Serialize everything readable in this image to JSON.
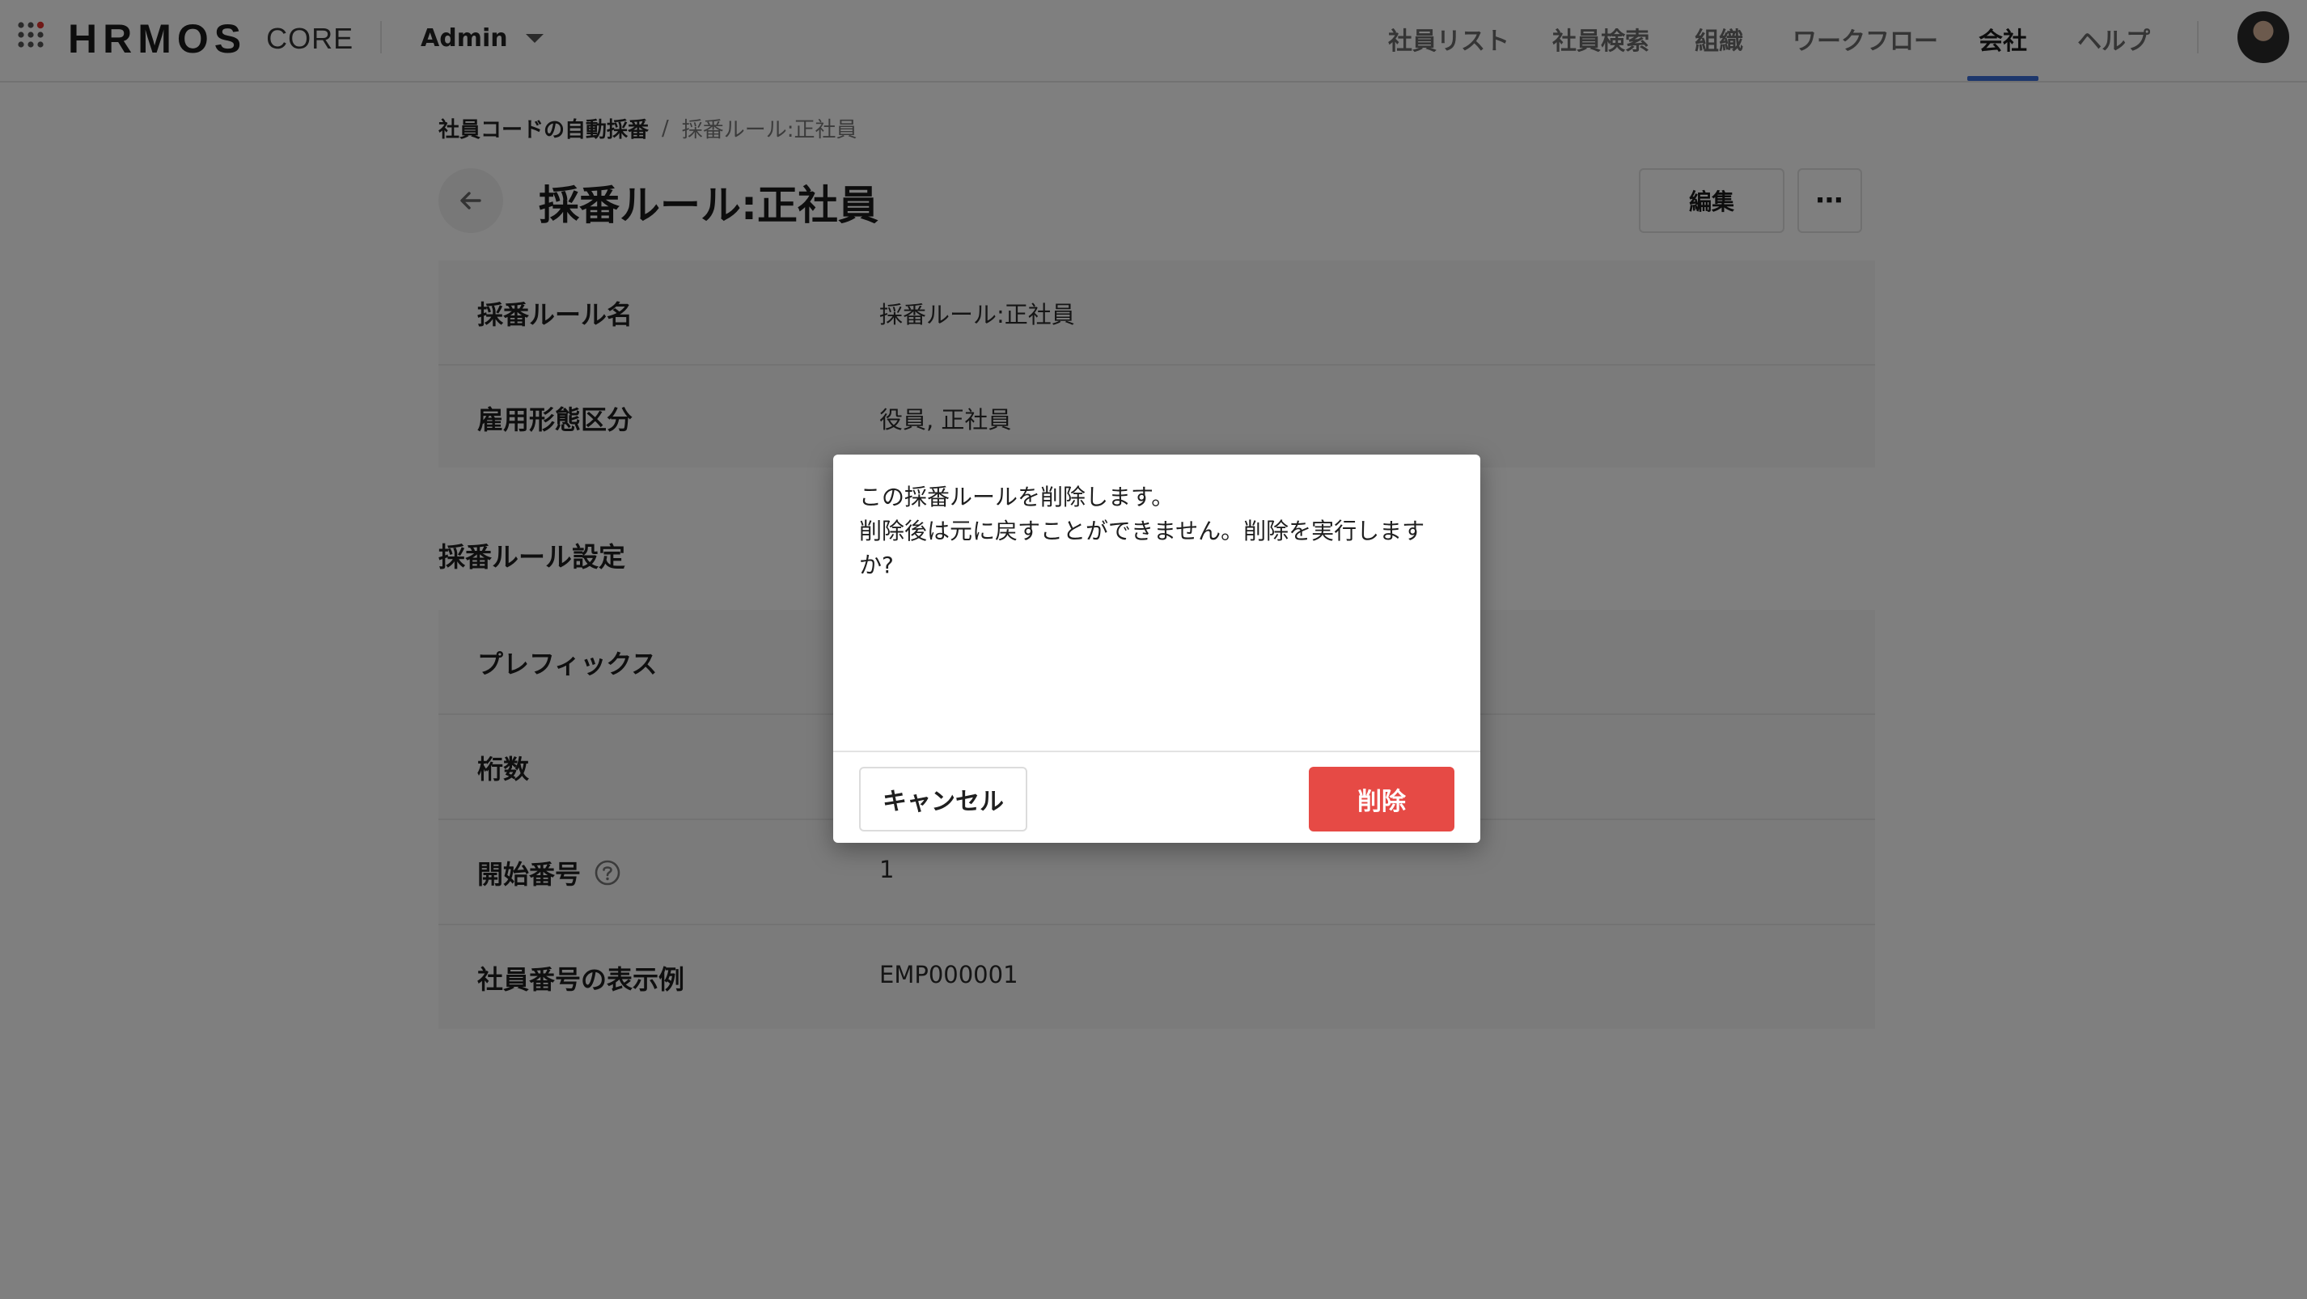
{
  "header": {
    "logo": "HRMOS",
    "logo_sub": "CORE",
    "tenant": "Admin",
    "nav": [
      {
        "label": "社員リスト"
      },
      {
        "label": "社員検索"
      },
      {
        "label": "組織"
      },
      {
        "label": "ワークフロー"
      },
      {
        "label": "会社",
        "active": true
      },
      {
        "label": "ヘルプ"
      }
    ],
    "icons": {
      "apps": "apps-grid-icon",
      "caret": "chevron-down-icon",
      "avatar": "user-avatar"
    }
  },
  "breadcrumb": {
    "parent": "社員コードの自動採番",
    "separator": "/",
    "current": "採番ルール:正社員"
  },
  "page": {
    "title": "採番ルール:正社員",
    "edit_label": "編集",
    "more_label": "⋯"
  },
  "basic_info": {
    "rows": [
      {
        "label": "採番ルール名",
        "value": "採番ルール:正社員"
      },
      {
        "label": "雇用形態区分",
        "value": "役員, 正社員"
      }
    ]
  },
  "settings": {
    "title": "採番ルール設定",
    "rows": [
      {
        "label": "プレフィックス",
        "value": ""
      },
      {
        "label": "桁数",
        "value": ""
      },
      {
        "label": "開始番号",
        "value": "1"
      },
      {
        "label": "社員番号の表示例",
        "value": "EMP000001"
      }
    ]
  },
  "modal": {
    "line1": "この採番ルールを削除します。",
    "line2": "削除後は元に戻すことができません。削除を実行しますか?",
    "cancel_label": "キャンセル",
    "delete_label": "削除"
  },
  "colors": {
    "accent": "#3b6fd8",
    "danger": "#e64a45",
    "overlay": "rgba(0,0,0,0.5)"
  }
}
